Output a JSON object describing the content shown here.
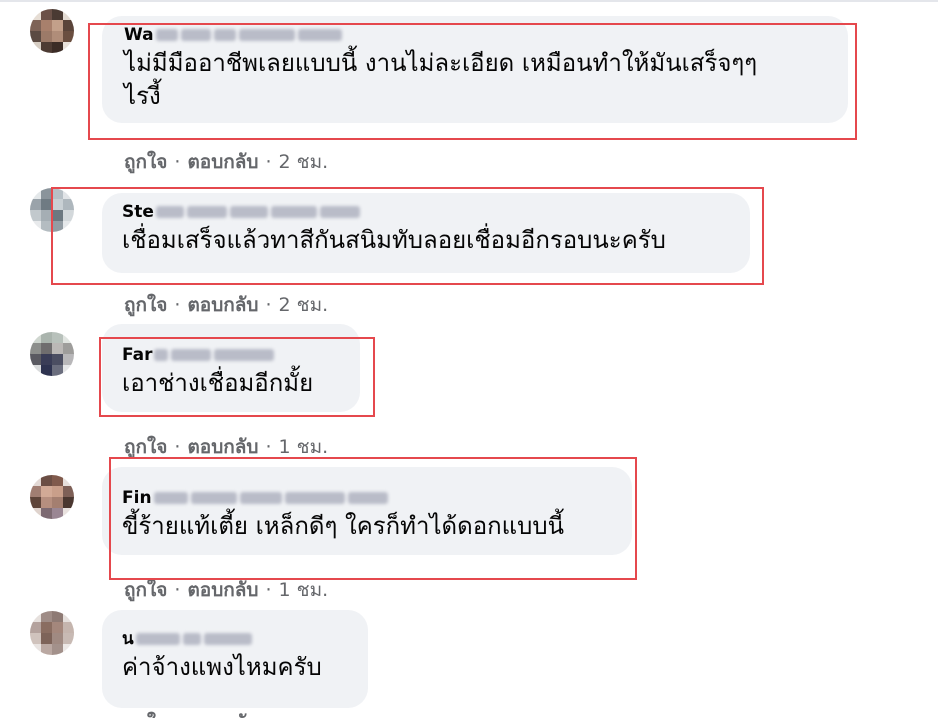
{
  "comments": [
    {
      "name_visible": "Wa",
      "text": "ไม่มีมืออาชีพเลยแบบนี้ งานไม่ละเอียด เหมือนทำให้มันเสร็จๆๆ\nไรงี้",
      "time": "2 ชม."
    },
    {
      "name_visible": "Ste",
      "text": "เชื่อมเสร็จแล้วทาสีกันสนิมทับลอยเชื่อมอีกรอบนะครับ",
      "time": "2 ชม."
    },
    {
      "name_visible": "Far",
      "text": "เอาช่างเชื่อมอีกมั้ย",
      "time": "1 ชม."
    },
    {
      "name_visible": "Fin",
      "text": "ขี้ร้ายแท้เตี้ย เหล็กดีๆ ใครก็ทำได้ดอกแบบนี้",
      "time": "1 ชม."
    },
    {
      "name_visible": "น",
      "text": "ค่าจ้างแพงไหมครับ",
      "time": ""
    }
  ],
  "actions": {
    "like_label": "ถูกใจ",
    "reply_label": "ตอบกลับ",
    "separator": "·"
  },
  "colors": {
    "bubble": "#f0f2f5",
    "highlight": "#e5484d",
    "meta": "#65676b"
  }
}
